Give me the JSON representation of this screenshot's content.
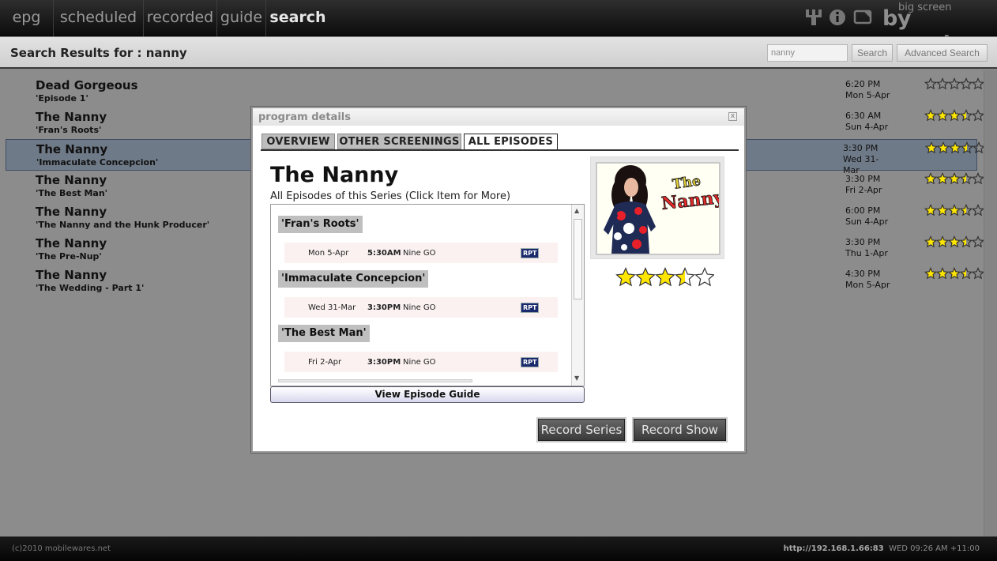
{
  "nav": {
    "items": [
      "epg",
      "scheduled",
      "recorded",
      "guide",
      "search"
    ],
    "active": "search",
    "brand_small": "big screen",
    "brand_big": "by remote",
    "icons": [
      "network-icon",
      "info-icon",
      "screen-icon"
    ]
  },
  "search": {
    "results_title": "Search Results for : nanny",
    "query": "nanny",
    "search_label": "Search",
    "advanced_label": "Advanced Search"
  },
  "results": [
    {
      "title": "Dead Gorgeous",
      "episode": "'Episode 1'",
      "time": "6:20 PM",
      "date": "Mon 5-Apr",
      "rating": 0
    },
    {
      "title": "The Nanny",
      "episode": "'Fran's Roots'",
      "time": "6:30 AM",
      "date": "Sun 4-Apr",
      "rating": 3.5
    },
    {
      "title": "The Nanny",
      "episode": "'Immaculate Concepcion'",
      "time": "3:30 PM",
      "date": "Wed 31-Mar",
      "rating": 3.5,
      "selected": true
    },
    {
      "title": "The Nanny",
      "episode": "'The Best Man'",
      "time": "3:30 PM",
      "date": "Fri 2-Apr",
      "rating": 3.5
    },
    {
      "title": "The Nanny",
      "episode": "'The Nanny and the Hunk Producer'",
      "time": "6:00 PM",
      "date": "Sun 4-Apr",
      "rating": 3.5
    },
    {
      "title": "The Nanny",
      "episode": "'The Pre-Nup'",
      "time": "3:30 PM",
      "date": "Thu 1-Apr",
      "rating": 3.5
    },
    {
      "title": "The Nanny",
      "episode": "'The Wedding - Part 1'",
      "time": "4:30 PM",
      "date": "Mon 5-Apr",
      "rating": 3.5
    }
  ],
  "modal": {
    "title": "program details",
    "close": "x",
    "tabs": [
      "OVERVIEW",
      "OTHER SCREENINGS",
      "ALL EPISODES"
    ],
    "active_tab": "ALL EPISODES",
    "show_title": "The Nanny",
    "subhead": "All Episodes of this Series (Click Item for More)",
    "episodes": [
      {
        "title": "'Fran's Roots'",
        "date": "Mon 5-Apr",
        "time": "5:30AM",
        "channel": "Nine GO",
        "badge": "RPT"
      },
      {
        "title": "'Immaculate Concepcion'",
        "date": "Wed 31-Mar",
        "time": "3:30PM",
        "channel": "Nine GO",
        "badge": "RPT"
      },
      {
        "title": "'The Best Man'",
        "date": "Fri 2-Apr",
        "time": "3:30PM",
        "channel": "Nine GO",
        "badge": "RPT"
      }
    ],
    "guide_button": "View Episode Guide",
    "rating": 3.5,
    "poster_logo": "The Nanny",
    "record_series": "Record Series",
    "record_show": "Record Show"
  },
  "footer": {
    "copyright": "(c)2010 mobilewares.net",
    "address": "http://192.168.1.66:83",
    "datetime": "WED 09:26 AM +11:00"
  },
  "colors": {
    "star_fill": "#ffe600",
    "star_outline": "#333333",
    "badge": "#1a2a6c"
  }
}
